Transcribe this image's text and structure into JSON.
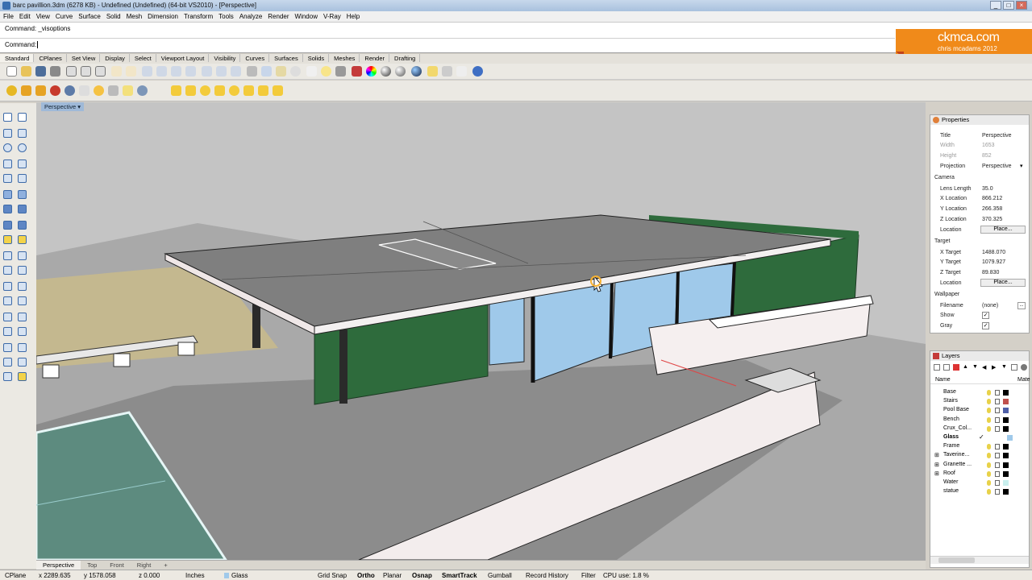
{
  "window": {
    "title": "barc pavillion.3dm (6278 KB) - Undefined (Undefined) (64-bit VS2010) - [Perspective]"
  },
  "menu": [
    "File",
    "Edit",
    "View",
    "Curve",
    "Surface",
    "Solid",
    "Mesh",
    "Dimension",
    "Transform",
    "Tools",
    "Analyze",
    "Render",
    "Window",
    "V-Ray",
    "Help"
  ],
  "command": {
    "history": "Command: _visoptions",
    "prompt": "Command:"
  },
  "logo": {
    "line1": "ckmca.com",
    "line2": "chris mcadams 2012"
  },
  "toolbar_tabs": [
    "Standard",
    "CPlanes",
    "Set View",
    "Display",
    "Select",
    "Viewport Layout",
    "Visibility",
    "Curves",
    "Surfaces",
    "Solids",
    "Meshes",
    "Render",
    "Drafting"
  ],
  "viewport": {
    "label": "Perspective",
    "tabs": [
      "Perspective",
      "Top",
      "Front",
      "Right"
    ]
  },
  "properties": {
    "header": "Properties",
    "title_label": "Title",
    "title_value": "Perspective",
    "width_label": "Width",
    "width_value": "1653",
    "height_label": "Height",
    "height_value": "852",
    "projection_label": "Projection",
    "projection_value": "Perspective",
    "camera_section": "Camera",
    "lens_label": "Lens Length",
    "lens_value": "35.0",
    "xloc_label": "X Location",
    "xloc_value": "866.212",
    "yloc_label": "Y Location",
    "yloc_value": "266.358",
    "zloc_label": "Z Location",
    "zloc_value": "370.325",
    "location_label": "Location",
    "place_button": "Place...",
    "target_section": "Target",
    "xt_label": "X Target",
    "xt_value": "1488.070",
    "yt_label": "Y Target",
    "yt_value": "1079.927",
    "zt_label": "Z Target",
    "zt_value": "89.830",
    "tlocation_label": "Location",
    "tplace_button": "Place...",
    "wallpaper_section": "Wallpaper",
    "filename_label": "Filename",
    "filename_value": "(none)",
    "show_label": "Show",
    "gray_label": "Gray"
  },
  "layers": {
    "header": "Layers",
    "col_name": "Name",
    "col_material": "Mate",
    "items": [
      {
        "name": "Base",
        "color": "#000000"
      },
      {
        "name": "Stairs",
        "color": "#c0504d"
      },
      {
        "name": "Pool Base",
        "color": "#4f5fa8"
      },
      {
        "name": "Bench",
        "color": "#000000"
      },
      {
        "name": "Crux_Col...",
        "color": "#000000"
      },
      {
        "name": "Glass",
        "color": "#9fc9ea",
        "current": true
      },
      {
        "name": "Frame",
        "color": "#000000"
      },
      {
        "name": "Taverine...",
        "color": "#000000",
        "expand": true
      },
      {
        "name": "Granette ...",
        "color": "#000000",
        "expand": true
      },
      {
        "name": "Roof",
        "color": "#000000",
        "expand": true
      },
      {
        "name": "Water",
        "color": "#c9efee"
      },
      {
        "name": "statue",
        "color": "#000000"
      }
    ]
  },
  "status": {
    "cplane": "CPlane",
    "x": "x 2289.635",
    "y": "y 1578.058",
    "z": "z 0.000",
    "units": "Inches",
    "layer": "Glass",
    "grid_snap": "Grid Snap",
    "ortho": "Ortho",
    "planar": "Planar",
    "osnap": "Osnap",
    "smarttrack": "SmartTrack",
    "gumball": "Gumball",
    "record_history": "Record History",
    "filter": "Filter",
    "cpu": "CPU use: 1.8 %"
  },
  "colors": {
    "accent": "#f08a1a",
    "glass": "#9fc9ea",
    "wall_green": "#2e6b3c"
  }
}
